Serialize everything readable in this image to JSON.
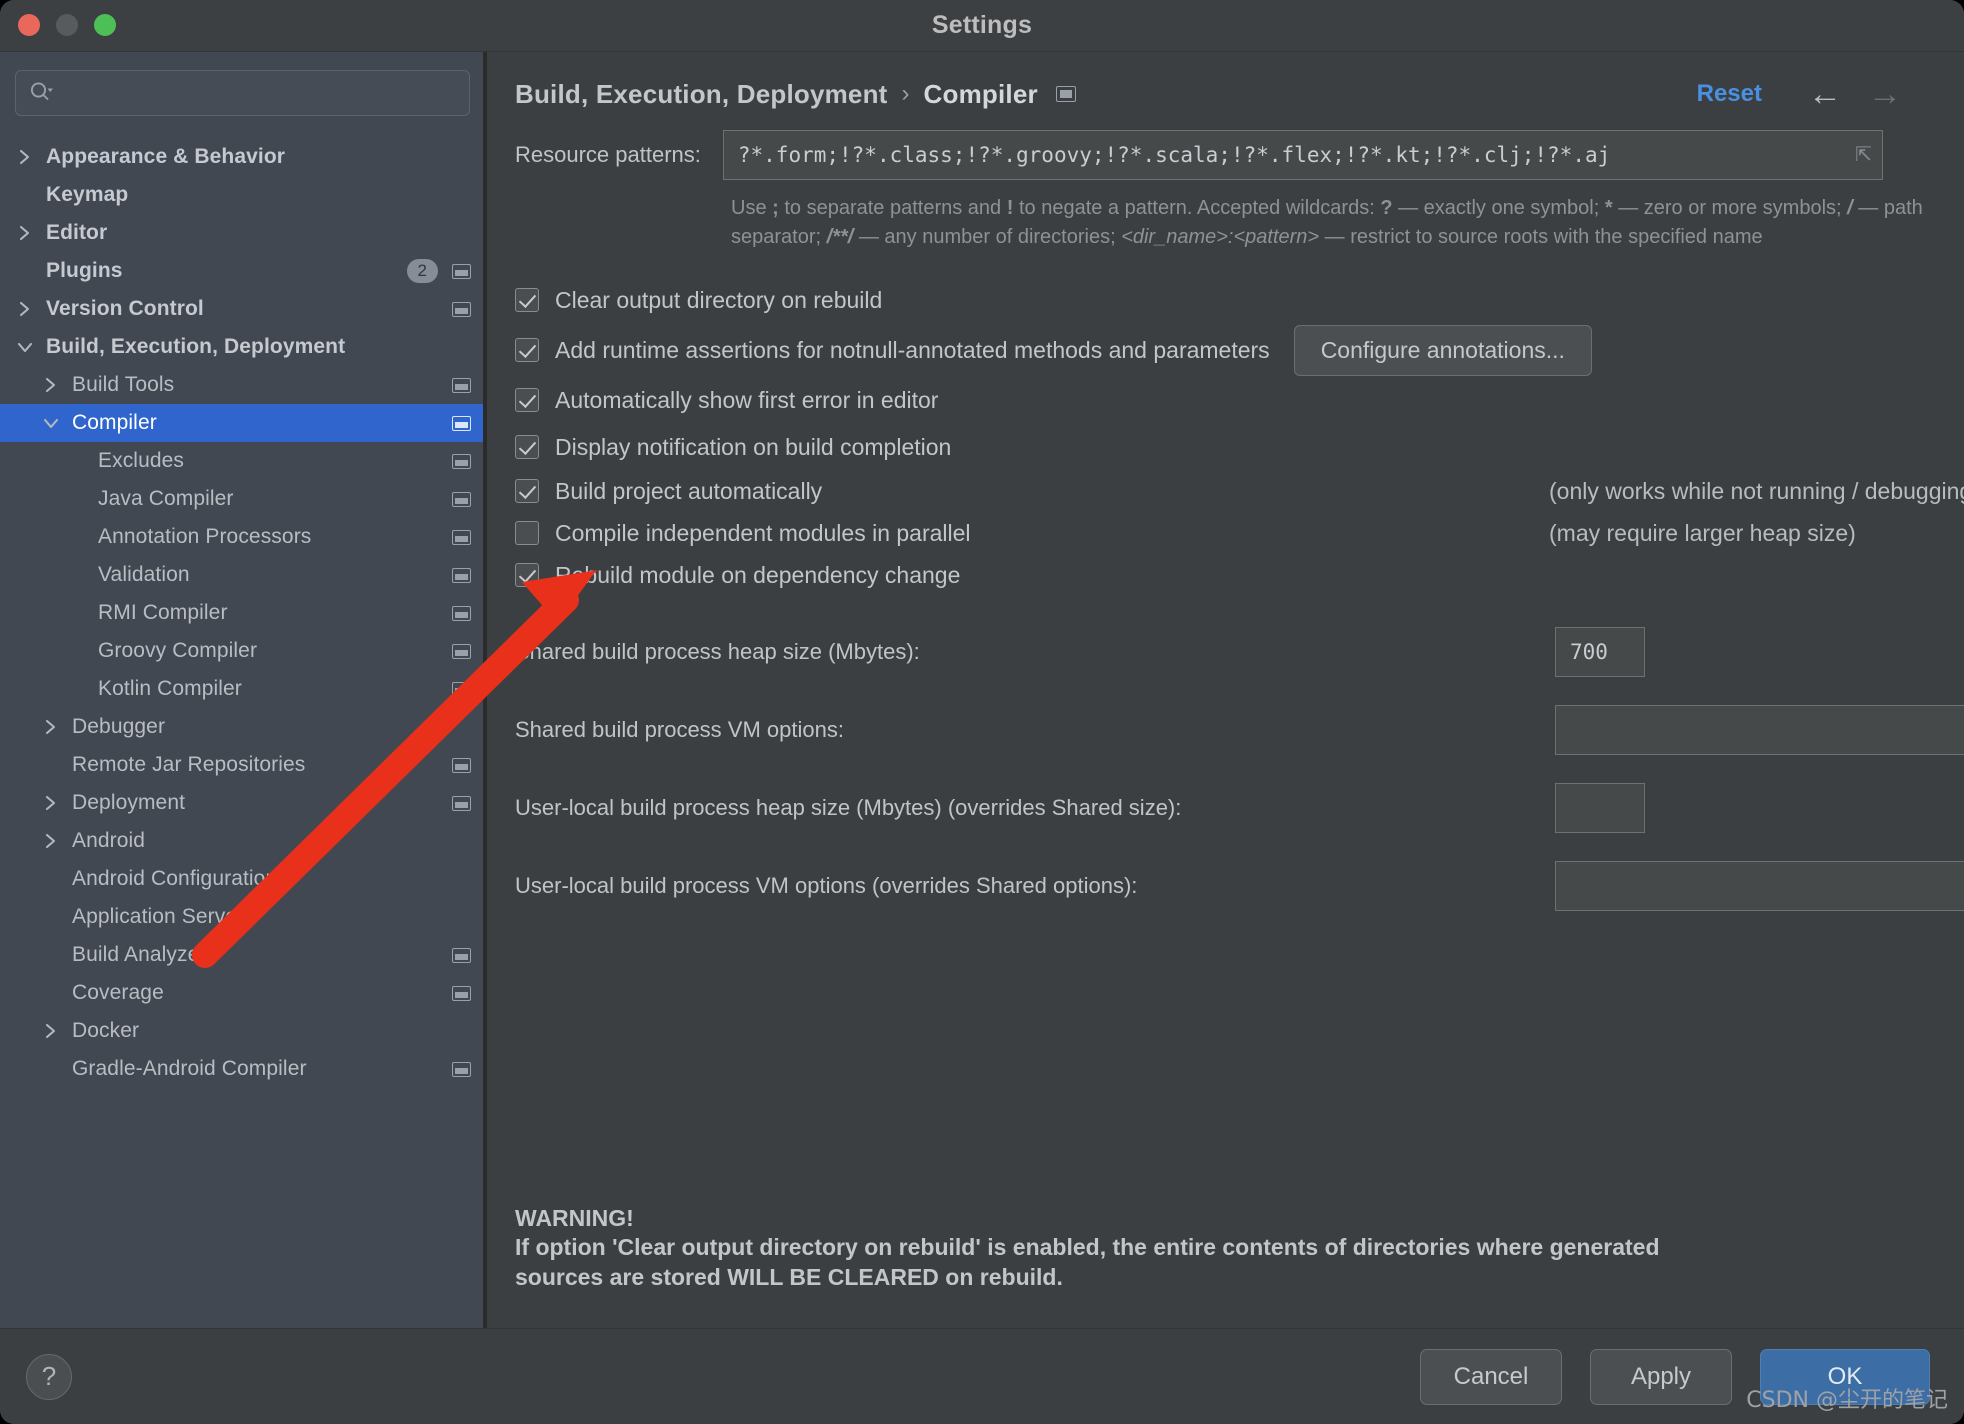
{
  "window": {
    "title": "Settings",
    "traffic_lights": [
      "close",
      "minimize",
      "zoom"
    ]
  },
  "sidebar": {
    "search": {
      "value": "",
      "placeholder": ""
    },
    "items": [
      {
        "label": "Appearance & Behavior",
        "arrow": "right",
        "bold": true,
        "indent": 0,
        "mark": false
      },
      {
        "label": "Keymap",
        "arrow": "none",
        "bold": true,
        "indent": 0,
        "mark": false
      },
      {
        "label": "Editor",
        "arrow": "right",
        "bold": true,
        "indent": 0,
        "mark": false
      },
      {
        "label": "Plugins",
        "arrow": "none",
        "bold": true,
        "indent": 0,
        "mark": true,
        "badge": "2"
      },
      {
        "label": "Version Control",
        "arrow": "right",
        "bold": true,
        "indent": 0,
        "mark": true
      },
      {
        "label": "Build, Execution, Deployment",
        "arrow": "down",
        "bold": true,
        "indent": 0,
        "mark": false
      },
      {
        "label": "Build Tools",
        "arrow": "right",
        "bold": false,
        "indent": 1,
        "mark": true
      },
      {
        "label": "Compiler",
        "arrow": "down",
        "bold": false,
        "indent": 1,
        "mark": true,
        "selected": true
      },
      {
        "label": "Excludes",
        "arrow": "none",
        "bold": false,
        "indent": 2,
        "mark": true
      },
      {
        "label": "Java Compiler",
        "arrow": "none",
        "bold": false,
        "indent": 2,
        "mark": true
      },
      {
        "label": "Annotation Processors",
        "arrow": "none",
        "bold": false,
        "indent": 2,
        "mark": true
      },
      {
        "label": "Validation",
        "arrow": "none",
        "bold": false,
        "indent": 2,
        "mark": true
      },
      {
        "label": "RMI Compiler",
        "arrow": "none",
        "bold": false,
        "indent": 2,
        "mark": true
      },
      {
        "label": "Groovy Compiler",
        "arrow": "none",
        "bold": false,
        "indent": 2,
        "mark": true
      },
      {
        "label": "Kotlin Compiler",
        "arrow": "none",
        "bold": false,
        "indent": 2,
        "mark": true
      },
      {
        "label": "Debugger",
        "arrow": "right",
        "bold": false,
        "indent": 1,
        "mark": false
      },
      {
        "label": "Remote Jar Repositories",
        "arrow": "none",
        "bold": false,
        "indent": 1,
        "mark": true
      },
      {
        "label": "Deployment",
        "arrow": "right",
        "bold": false,
        "indent": 1,
        "mark": true
      },
      {
        "label": "Android",
        "arrow": "right",
        "bold": false,
        "indent": 1,
        "mark": false
      },
      {
        "label": "Android Configurations",
        "arrow": "none",
        "bold": false,
        "indent": 1,
        "mark": false
      },
      {
        "label": "Application Servers",
        "arrow": "none",
        "bold": false,
        "indent": 1,
        "mark": false
      },
      {
        "label": "Build Analyzer",
        "arrow": "none",
        "bold": false,
        "indent": 1,
        "mark": true
      },
      {
        "label": "Coverage",
        "arrow": "none",
        "bold": false,
        "indent": 1,
        "mark": true
      },
      {
        "label": "Docker",
        "arrow": "right",
        "bold": false,
        "indent": 1,
        "mark": false
      },
      {
        "label": "Gradle-Android Compiler",
        "arrow": "none",
        "bold": false,
        "indent": 1,
        "mark": true
      }
    ]
  },
  "header": {
    "breadcrumb_parent": "Build, Execution, Deployment",
    "breadcrumb_separator": "›",
    "breadcrumb_current": "Compiler",
    "reset_label": "Reset",
    "back_arrow": "←",
    "forward_arrow": "→"
  },
  "main": {
    "resource_patterns_label": "Resource patterns:",
    "resource_patterns_value": "?*.form;!?*.class;!?*.groovy;!?*.scala;!?*.flex;!?*.kt;!?*.clj;!?*.aj",
    "resource_patterns_hint_line1_a": "Use ",
    "resource_patterns_hint_semicolon": ";",
    "resource_patterns_hint_line1_b": " to separate patterns and ",
    "resource_patterns_hint_bang": "!",
    "resource_patterns_hint_line1_c": " to negate a pattern. Accepted wildcards: ",
    "resource_patterns_hint_q": "?",
    "resource_patterns_hint_line1_d": " — exactly one symbol; ",
    "resource_patterns_hint_star": "*",
    "resource_patterns_hint_line1_e": " — zero or more symbols; ",
    "resource_patterns_hint_slash": "/",
    "resource_patterns_hint_line2_a": " — path separator; ",
    "resource_patterns_hint_dblstar": "/**/",
    "resource_patterns_hint_line2_b": " — any number of directories; ",
    "resource_patterns_hint_dirname": "<dir_name>:<pattern>",
    "resource_patterns_hint_line2_c": " — restrict to source roots with the specified name",
    "checkboxes": [
      {
        "label": "Clear output directory on rebuild",
        "checked": true
      },
      {
        "label": "Add runtime assertions for notnull-annotated methods and parameters",
        "checked": true
      },
      {
        "label": "Automatically show first error in editor",
        "checked": true
      },
      {
        "label": "Display notification on build completion",
        "checked": true
      },
      {
        "label": "Build project automatically",
        "checked": true
      },
      {
        "label": "Compile independent modules in parallel",
        "checked": false
      },
      {
        "label": "Rebuild module on dependency change",
        "checked": true
      }
    ],
    "configure_annotations_label": "Configure annotations...",
    "note_build_auto": "(only works while not running / debugging)",
    "note_parallel": "(may require larger heap size)",
    "fields": [
      {
        "label": "Shared build process heap size (Mbytes):",
        "value": "700",
        "wide": false,
        "expand": false
      },
      {
        "label": "Shared build process VM options:",
        "value": "",
        "wide": true,
        "expand": true
      },
      {
        "label": "User-local build process heap size (Mbytes) (overrides Shared size):",
        "value": "",
        "wide": false,
        "expand": false
      },
      {
        "label": "User-local build process VM options (overrides Shared options):",
        "value": "",
        "wide": true,
        "expand": true
      }
    ],
    "warning_title": "WARNING!",
    "warning_line1": "If option 'Clear output directory on rebuild' is enabled, the entire contents of directories where generated",
    "warning_line2": "sources are stored WILL BE CLEARED on rebuild."
  },
  "footer": {
    "help_label": "?",
    "cancel_label": "Cancel",
    "apply_label": "Apply",
    "ok_label": "OK"
  },
  "watermark": "CSDN @尘开的笔记",
  "colors": {
    "accent_blue": "#2f65cc",
    "reset_blue": "#4a90e2",
    "ok_button": "#3c6ea5",
    "arrow_red": "#e8301b",
    "window_bg": "#3c3f41",
    "sidebar_bg": "#414852"
  }
}
